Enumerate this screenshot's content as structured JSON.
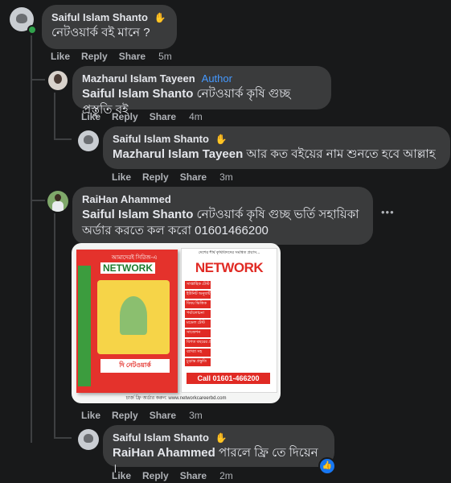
{
  "comments": [
    {
      "name": "Saiful Islam Shanto",
      "text": "নেটওয়ার্ক বই মানে ?",
      "time": "5m"
    },
    {
      "name": "Mazharul Islam Tayeen",
      "author_label": "Author",
      "mention": "Saiful Islam Shanto",
      "text": " নেটওয়ার্ক কৃষি গুচ্ছ প্রস্তুতি বই",
      "time": "4m"
    },
    {
      "name": "Saiful Islam Shanto",
      "mention": "Mazharul Islam Tayeen",
      "text": " আর কত বইয়ের নাম শুনতে হবে আল্লাহ",
      "time": "3m"
    },
    {
      "name": "RaiHan Ahammed",
      "mention": "Saiful Islam Shanto",
      "text_line1": " নেটওয়ার্ক কৃষি গুচ্ছ ভর্তি সহায়িকা",
      "text_line2": "অর্ডার করতে কল করো 01601466200",
      "time": "3m",
      "more": "•••"
    },
    {
      "name": "Saiful Islam Shanto",
      "mention": "RaiHan Ahammed",
      "text": " পারলে ফ্রি তে দিয়েন ।",
      "time": "2m"
    }
  ],
  "actions": {
    "like": "Like",
    "reply": "Reply",
    "share": "Share"
  },
  "ad_image": {
    "brand": "NETWORK",
    "tagline": "দেশের শীর্ষ কৃষিবিদদের সমন্বিত প্রয়াস...",
    "call": "Call 01601-466200",
    "footer": "চার্জ ফ্রি অর্ডার করুন: www.networkcareerbd.com",
    "book_title": "NETWORK",
    "book_header": "আমাদেরই সিরিজ-এ",
    "book_publisher": "দি নেটওয়ার্ক",
    "list_items": [
      "সাপ্তাহিক টেস্ট",
      "ইউনিট অনুযায়ী",
      "বিষয় ভিত্তিক",
      "পর্যালোচনা",
      "মডেল টেস্ট",
      "সাজেশন",
      "বিগত বছরের প্রশ্ন",
      "ব্যাখ্যা সহ",
      "চূড়ান্ত প্রস্তুতি"
    ]
  },
  "colors": {
    "background": "#18191a",
    "bubble": "#3a3b3c",
    "muted_text": "#b0b3b8",
    "author": "#4599ff",
    "ad_red": "#e02a24",
    "ad_green": "#4aa444"
  }
}
